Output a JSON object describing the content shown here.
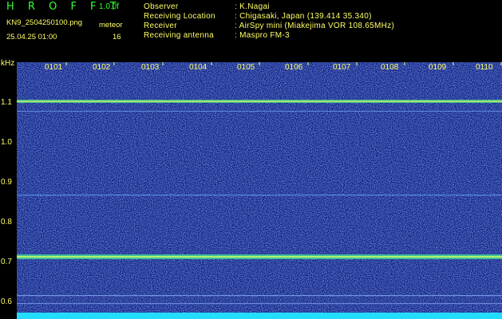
{
  "header": {
    "title": "H R O F F T",
    "version": "1.0.0f",
    "filename": "KN9_2504250100.png",
    "timestamp": "25.04.25 01:00",
    "meteor_label": "meteor",
    "meteor_count": "16"
  },
  "info": [
    {
      "key": "Observer",
      "value": ": K.Nagai"
    },
    {
      "key": "Receiving Location",
      "value": ": Chigasaki, Japan (139.414 35.340)"
    },
    {
      "key": "Receiver",
      "value": ": AirSpy mini (Miakejima VOR 108.65MHz)"
    },
    {
      "key": "Receiving antenna",
      "value": ": Maspro FM-3"
    }
  ],
  "axis": {
    "y_unit": "kHz",
    "x_ticks": [
      "0101",
      "0102",
      "0103",
      "0104",
      "0105",
      "0106",
      "0107",
      "0108",
      "0109",
      "0110"
    ],
    "y_ticks": [
      "1.1",
      "1.0",
      "0.9",
      "0.8",
      "0.7",
      "0.6"
    ]
  },
  "colors": {
    "background": "#000000",
    "spectrogram_base": "#0a1a80",
    "label": "#ffff66",
    "title": "#33ff33"
  }
}
